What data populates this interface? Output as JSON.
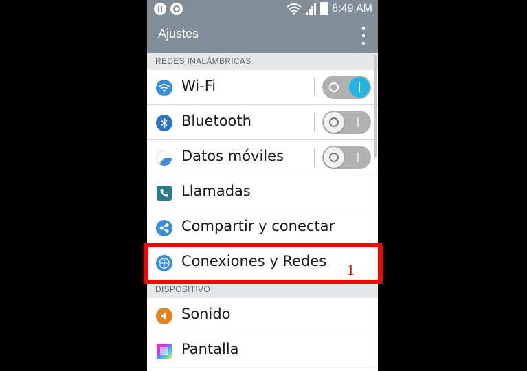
{
  "status_bar": {
    "time": "8:49 AM",
    "icons": [
      "pause-icon",
      "record-icon",
      "wifi-signal-icon",
      "cell-signal-icon",
      "battery-icon"
    ]
  },
  "app_bar": {
    "title": "Ajustes",
    "menu_icon": "overflow-menu-icon"
  },
  "sections": {
    "wireless": "REDES INALÁMBRICAS",
    "device": "DISPOSITIVO"
  },
  "items": [
    {
      "label": "Wi-Fi",
      "icon": "wifi-icon",
      "toggle": "on"
    },
    {
      "label": "Bluetooth",
      "icon": "bluetooth-icon",
      "toggle": "off"
    },
    {
      "label": "Datos móviles",
      "icon": "mobile-data-icon",
      "toggle": "off"
    },
    {
      "label": "Llamadas",
      "icon": "phone-icon"
    },
    {
      "label": "Compartir y conectar",
      "icon": "share-icon"
    },
    {
      "label": "Conexiones y Redes",
      "icon": "networks-icon"
    },
    {
      "label": "Sonido",
      "icon": "speaker-icon"
    },
    {
      "label": "Pantalla",
      "icon": "display-icon"
    }
  ],
  "annotation": {
    "number": "1",
    "color": "#ff0000"
  },
  "colors": {
    "header": "#818d97",
    "toggle_on": "#1fb6e4",
    "icon_blue": "#3a8fd8"
  }
}
